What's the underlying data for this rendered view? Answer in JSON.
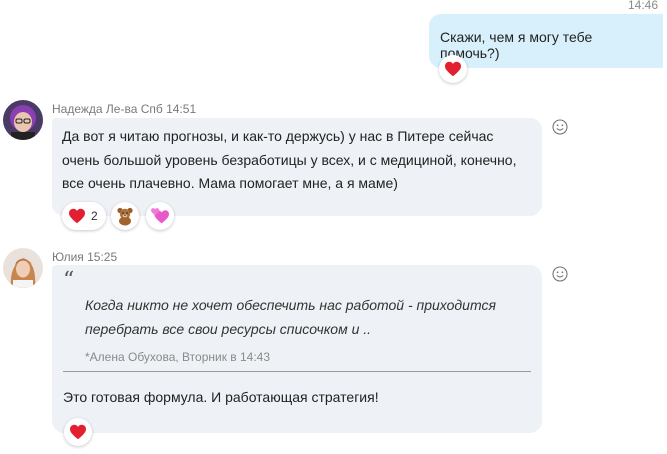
{
  "outgoing": {
    "time": "14:46",
    "text": "Скажи, чем я могу тебе помочь?)",
    "reaction_icon": "heart-icon"
  },
  "message1": {
    "sender": "Надежда Ле-ва Спб 14:51",
    "text": "Да вот я читаю прогнозы, и как-то держусь) у нас в Питере сейчас очень большой уровень безработицы у всех, и с медициной, конечно, все очень плачевно. Мама помогает мне, а я маме)",
    "reactions": [
      {
        "icon": "heart-icon",
        "count": "2"
      },
      {
        "icon": "teddy-bear-icon"
      },
      {
        "icon": "pink-hearts-icon"
      }
    ]
  },
  "message2": {
    "sender": "Юлия 15:25",
    "quote_text": "Когда никто не хочет обеспечить нас работой - приходится перебрать все свои ресурсы списочком и ..",
    "quote_meta": "*Алена Обухова, Вторник в 14:43",
    "text": "Это готовая формула. И работающая стратегия!",
    "reactions": [
      {
        "icon": "heart-icon"
      }
    ]
  },
  "colors": {
    "outgoing_bubble": "#d7f0fb",
    "incoming_bubble": "#eef1f5",
    "heart": "#e3202f"
  }
}
